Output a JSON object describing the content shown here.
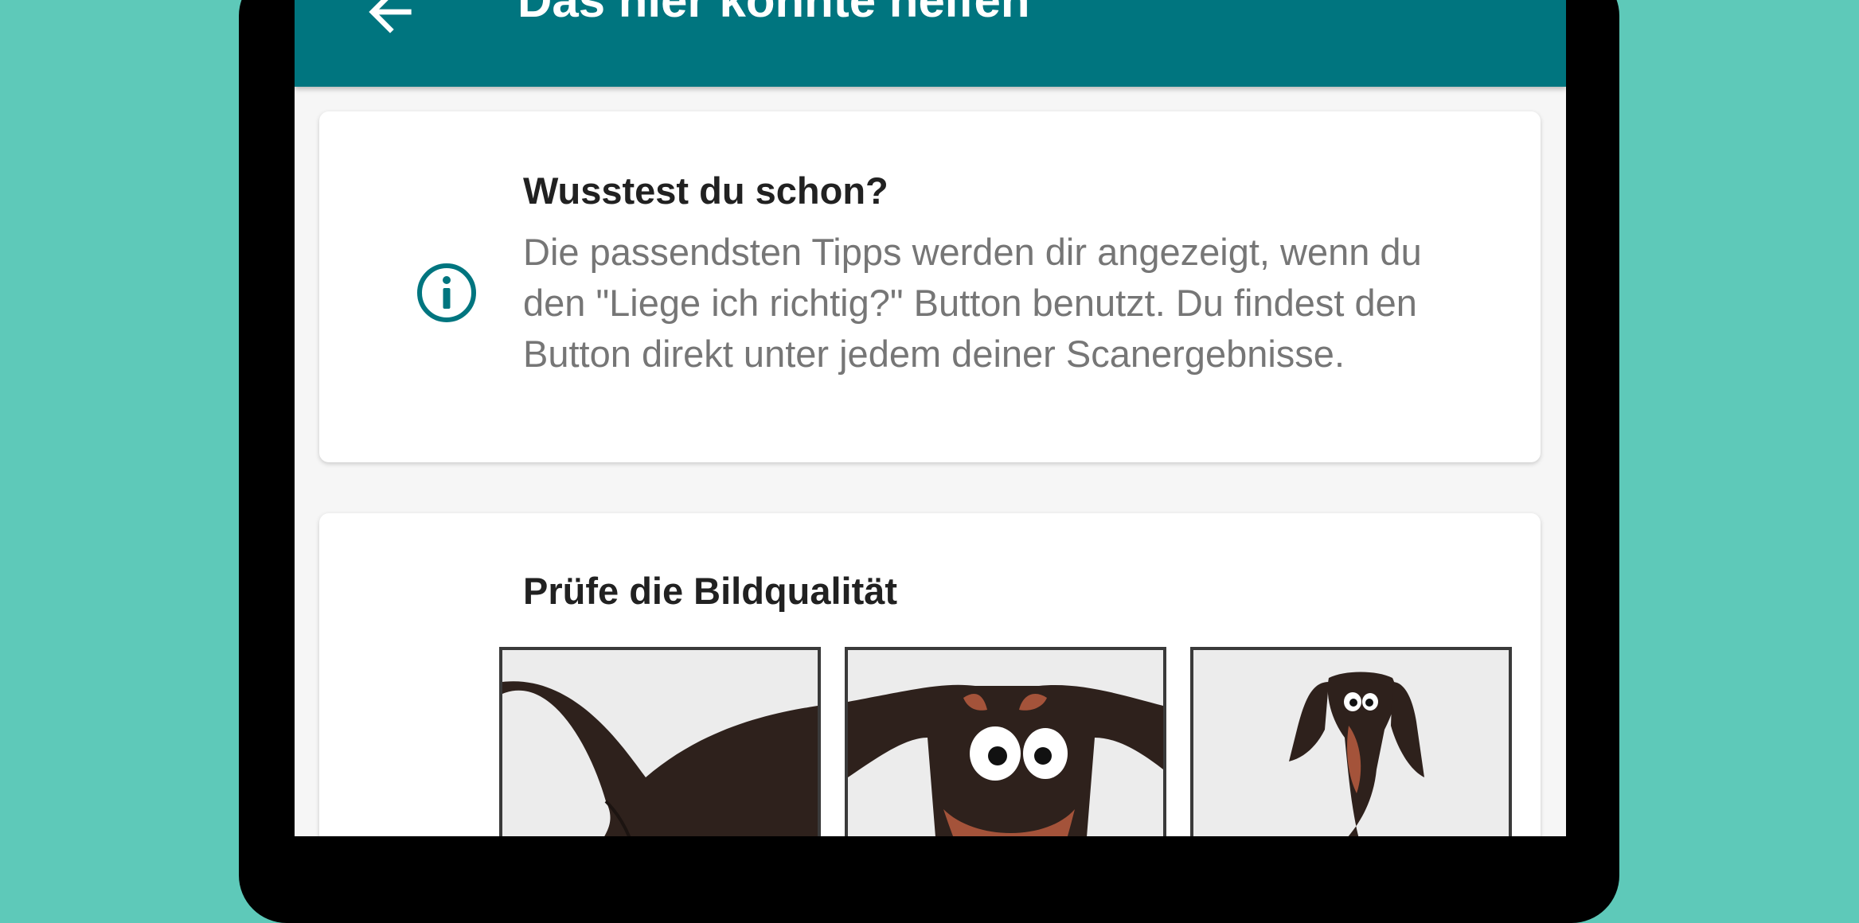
{
  "appbar": {
    "title": "Das hier könnte helfen",
    "back_icon": "arrow-left-icon",
    "color": "#00757f"
  },
  "info_card": {
    "icon": "info-icon",
    "title": "Wusstest du schon?",
    "body": "Die passendsten Tipps werden dir angezeigt, wenn du den \"Liege ich richtig?\" Button benutzt. Du findest den Button direkt unter jedem deiner Scanergebnisse."
  },
  "quality_card": {
    "title": "Prüfe die Bildqualität",
    "images": [
      {
        "name": "dog-closeup-image"
      },
      {
        "name": "dog-face-image"
      },
      {
        "name": "dog-far-image"
      }
    ]
  },
  "colors": {
    "background": "#5ec9b9",
    "accent": "#00757f",
    "dog_dark": "#2e211c",
    "dog_tan": "#a4533a"
  }
}
